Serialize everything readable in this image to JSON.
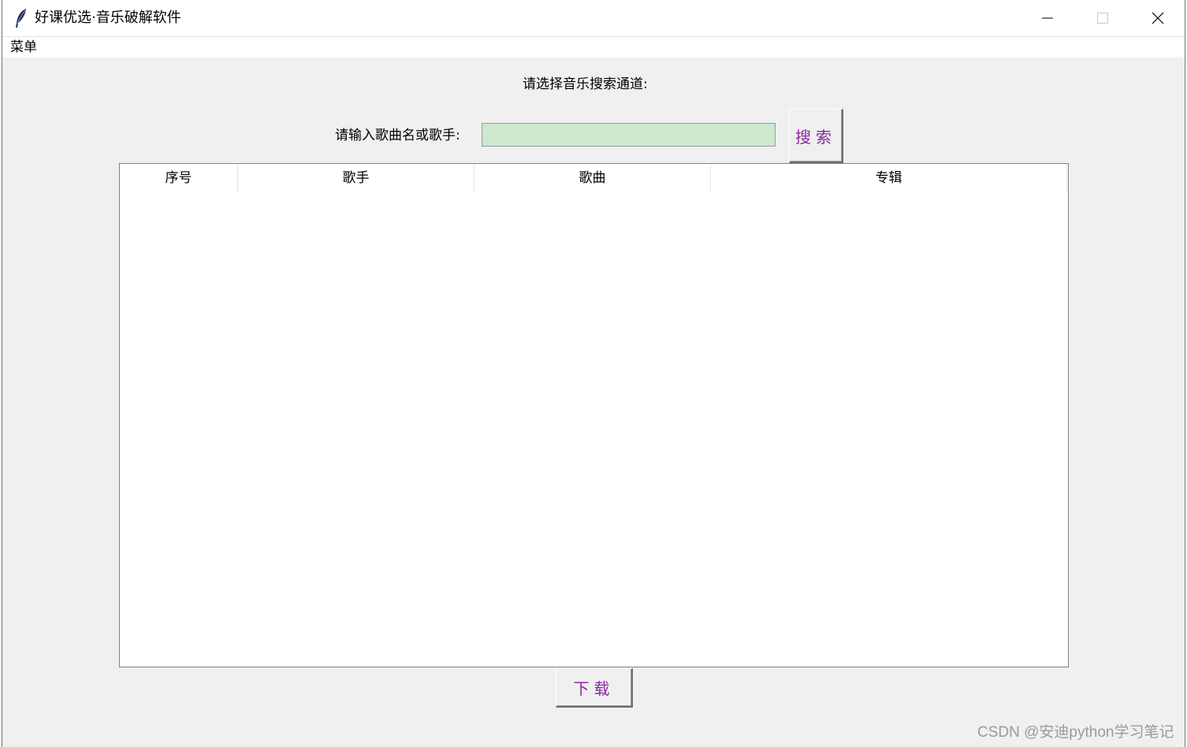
{
  "window": {
    "title": "好课优选·音乐破解软件",
    "icon": "feather-icon"
  },
  "menubar": {
    "items": [
      {
        "label": "菜单"
      }
    ]
  },
  "main": {
    "channel_label": "请选择音乐搜索通道:",
    "search_label": "请输入歌曲名或歌手:",
    "search_value": "",
    "search_button": "搜索",
    "download_button": "下载"
  },
  "table": {
    "columns": [
      {
        "label": "序号"
      },
      {
        "label": "歌手"
      },
      {
        "label": "歌曲"
      },
      {
        "label": "专辑"
      }
    ],
    "rows": []
  },
  "colors": {
    "input_bg": "#cce8cf",
    "button_text": "#8b2aa0"
  },
  "watermark": "CSDN @安迪python学习笔记"
}
